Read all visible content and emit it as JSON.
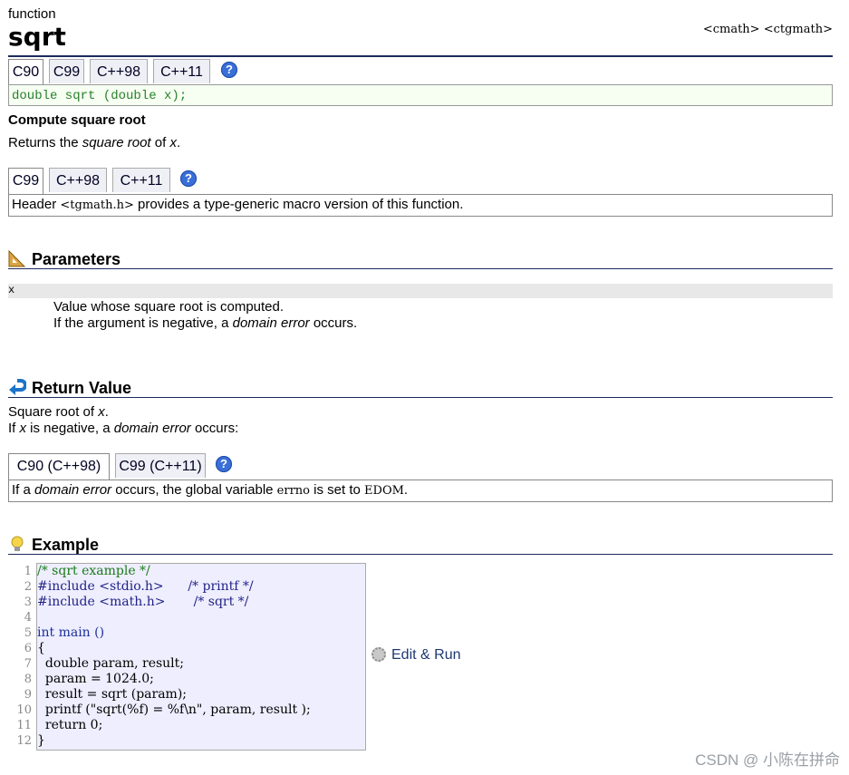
{
  "kind": "function",
  "name": "sqrt",
  "headers": "<cmath> <ctgmath>",
  "proto_tabs": [
    "C90",
    "C99",
    "C++98",
    "C++11"
  ],
  "prototype": "double sqrt (double x);",
  "summary_title": "Compute square root",
  "summary_parts": {
    "a": "Returns the ",
    "b": "square root",
    "c": " of ",
    "d": "x",
    "e": "."
  },
  "tg_tabs": [
    "C99",
    "C++98",
    "C++11"
  ],
  "tg_parts": {
    "a": "Header ",
    "b": "<tgmath.h>",
    "c": " provides a type-generic macro version of this function."
  },
  "params": {
    "heading": "Parameters",
    "name": "x",
    "line1": "Value whose square root is computed.",
    "line2a": "If the argument is negative, a ",
    "line2b": "domain error",
    "line2c": " occurs."
  },
  "return": {
    "heading": "Return Value",
    "l1a": "Square root of ",
    "l1b": "x",
    "l1c": ".",
    "l2a": "If ",
    "l2b": "x",
    "l2c": " is negative, a ",
    "l2d": "domain error",
    "l2e": " occurs:"
  },
  "err_tabs": [
    "C90 (C++98)",
    "C99 (C++11)"
  ],
  "err_parts": {
    "a": "If a ",
    "b": "domain error",
    "c": " occurs, the global variable ",
    "d": "errno",
    "e": " is set to ",
    "f": "EDOM",
    "g": "."
  },
  "example": {
    "heading": "Example",
    "line_numbers": [
      "1",
      "2",
      "3",
      "4",
      "5",
      "6",
      "7",
      "8",
      "9",
      "10",
      "11",
      "12"
    ],
    "lines": [
      "/* sqrt example */",
      "#include <stdio.h>      /* printf */",
      "#include <math.h>       /* sqrt */",
      "",
      "int main ()",
      "{",
      "  double param, result;",
      "  param = 1024.0;",
      "  result = sqrt (param);",
      "  printf (\"sqrt(%f) = %f\\n\", param, result );",
      "  return 0;",
      "}"
    ],
    "edit_label": "Edit & Run"
  },
  "watermark": "CSDN @ 小陈在拼命",
  "colors": {
    "accent": "#1e2a5e",
    "proto_text": "#28802a",
    "code_bg": "#eeeeff"
  }
}
